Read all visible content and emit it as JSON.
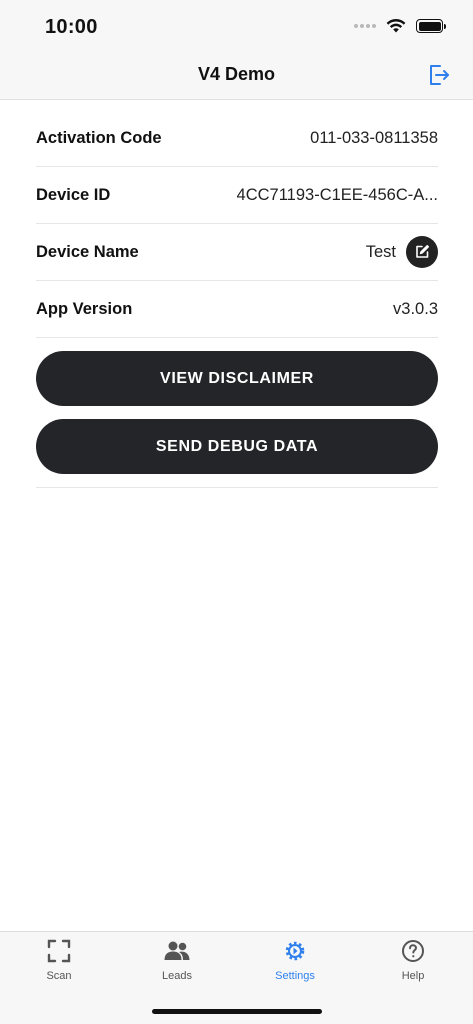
{
  "status_bar": {
    "time": "10:00"
  },
  "nav": {
    "title": "V4 Demo"
  },
  "settings": [
    {
      "label": "Activation Code",
      "value": "011-033-0811358"
    },
    {
      "label": "Device ID",
      "value": "4CC71193-C1EE-456C-A..."
    },
    {
      "label": "Device Name",
      "value": "Test"
    },
    {
      "label": "App Version",
      "value": "v3.0.3"
    }
  ],
  "actions": {
    "view_disclaimer": "VIEW DISCLAIMER",
    "send_debug": "SEND DEBUG DATA"
  },
  "tabs": [
    {
      "label": "Scan",
      "icon": "scan-icon"
    },
    {
      "label": "Leads",
      "icon": "people-icon"
    },
    {
      "label": "Settings",
      "icon": "gear-icon",
      "active": true
    },
    {
      "label": "Help",
      "icon": "help-icon"
    }
  ],
  "colors": {
    "accent": "#2f80ed",
    "button": "#242529",
    "bar": "#f7f7f7"
  }
}
